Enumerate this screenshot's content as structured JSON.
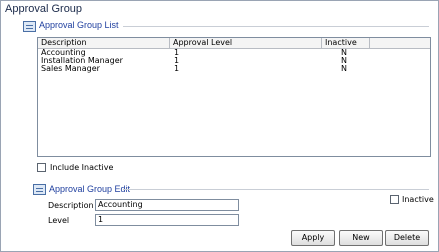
{
  "window": {
    "title": "Approval Group"
  },
  "list_section": {
    "title": "Approval Group List"
  },
  "table": {
    "columns": [
      "Description",
      "Approval Level",
      "Inactive"
    ],
    "rows": [
      [
        "Accounting",
        "1",
        "N"
      ],
      [
        "Installation Manager",
        "1",
        "N"
      ],
      [
        "Sales Manager",
        "1",
        "N"
      ]
    ]
  },
  "include_inactive": {
    "label": "Include Inactive",
    "checked": false
  },
  "edit_section": {
    "title": "Approval Group Edit",
    "description_label": "Description",
    "description_value": "Accounting",
    "level_label": "Level",
    "level_value": "1",
    "inactive_label": "Inactive",
    "inactive_checked": false
  },
  "buttons": {
    "apply": "Apply",
    "new": "New",
    "delete": "Delete"
  }
}
